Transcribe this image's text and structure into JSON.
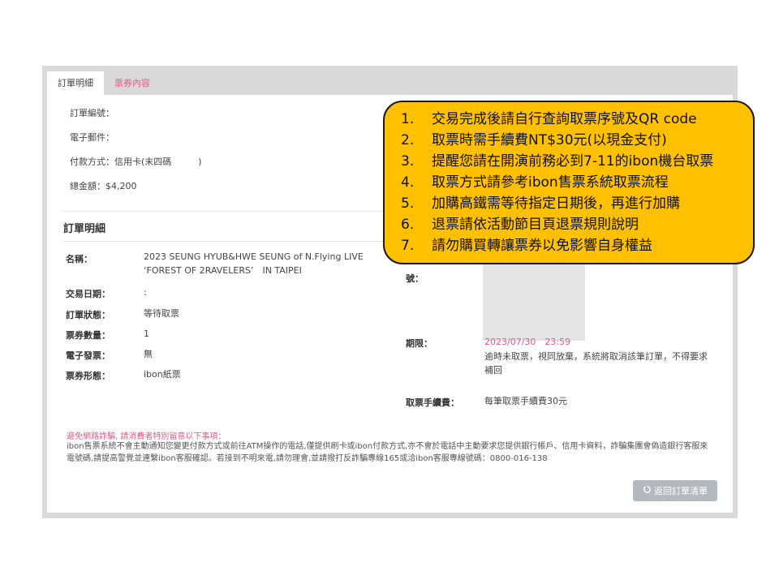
{
  "tabs": [
    {
      "label": "訂單明細",
      "active": true
    },
    {
      "label": "票券內容",
      "active": false
    }
  ],
  "order_info": {
    "order_no_label": "訂單編號：",
    "email_label": "電子郵件：",
    "payment": "付款方式：信用卡(末四碼　　　)",
    "total": "總金額：$4,200"
  },
  "section_title": "訂單明細",
  "details": [
    {
      "label": "名稱：",
      "value": "2023 SEUNG HYUB&HWE SEUNG of N.Flying LIVE ‘FOREST OF 2RAVELERS’　IN TAIPEI"
    },
    {
      "label": "交易日期：",
      "value": ":"
    },
    {
      "label": "訂單狀態：",
      "value": "等待取票"
    },
    {
      "label": "票券數量：",
      "value": "1"
    },
    {
      "label": "電子發票：",
      "value": "無"
    },
    {
      "label": "票券形態：",
      "value": "ibon紙票"
    }
  ],
  "right_details": {
    "number_label": "號：",
    "deadline_label": "期限：",
    "deadline_value": "2023/07/30　23:59",
    "deadline_note": "逾時未取票，視同放棄，系統將取消該筆訂單，不得要求補回",
    "fee_label": "取票手續費：",
    "fee_value": "每筆取票手續費30元"
  },
  "warning": {
    "title": "避免網路詐騙, 請消費者特別留意以下事項：",
    "text": "ibon售票系統不會主動通知您變更付款方式或前往ATM操作的電話,僅提供刷卡或ibon付款方式,亦不會於電話中主動要求您提供銀行帳戶、信用卡資料，詐騙集團會偽造銀行客服來電號碼,請提高警覺並連繫ibon客服確認。若接到不明來電,請勿理會,並請撥打反詐騙專線165或洽ibon客服專線號碼：0800-016-138"
  },
  "back_button": "返回訂單清單",
  "back_icon": "refresh-icon",
  "callout": [
    {
      "num": "1.",
      "text": "交易完成後請自行查詢取票序號及QR code"
    },
    {
      "num": "2.",
      "text": "取票時需手續費NT$30元(以現金支付)"
    },
    {
      "num": "3.",
      "text": "提醒您請在開演前務必到7-11的ibon機台取票"
    },
    {
      "num": "4.",
      "text": "取票方式請參考ibon售票系統取票流程"
    },
    {
      "num": "5.",
      "text": "加購高鐵需等待指定日期後，再進行加購"
    },
    {
      "num": "6.",
      "text": "退票請依活動節目頁退票規則說明"
    },
    {
      "num": "7.",
      "text": "請勿購買轉讓票券以免影響自身權益"
    }
  ],
  "colors": {
    "accent": "#e35a88",
    "callout_bg": "#ffc000",
    "frame": "#d9d9d9",
    "button": "#b3b9bf"
  }
}
